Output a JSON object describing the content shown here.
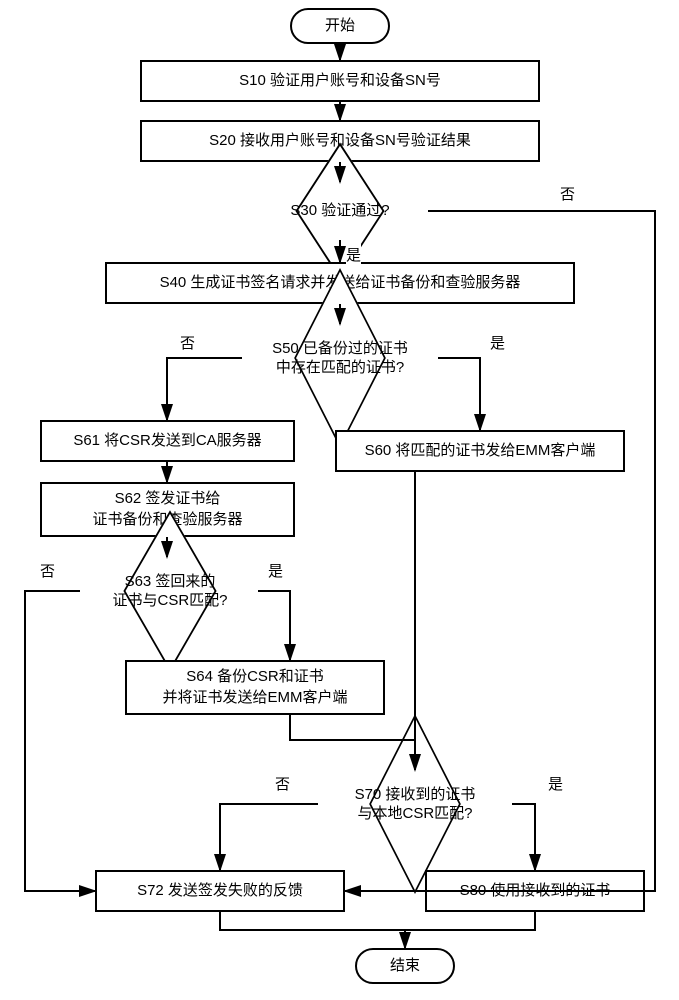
{
  "type": "flowchart",
  "start": "开始",
  "end": "结束",
  "s10": "S10  验证用户账号和设备SN号",
  "s20": "S20  接收用户账号和设备SN号验证结果",
  "s30": "S30  验证通过?",
  "s40": "S40  生成证书签名请求并发送给证书备份和查验服务器",
  "s50": "S50  已备份过的证书\n中存在匹配的证书?",
  "s60": "S60  将匹配的证书发给EMM客户端",
  "s61": "S61  将CSR发送到CA服务器",
  "s62": "S62  签发证书给\n证书备份和查验服务器",
  "s63": "S63  签回来的\n证书与CSR匹配?",
  "s64": "S64  备份CSR和证书\n并将证书发送给EMM客户端",
  "s70": "S70  接收到的证书\n与本地CSR匹配?",
  "s72": "S72  发送签发失败的反馈",
  "s80": "S80  使用接收到的证书",
  "labels": {
    "yes": "是",
    "no": "否"
  }
}
